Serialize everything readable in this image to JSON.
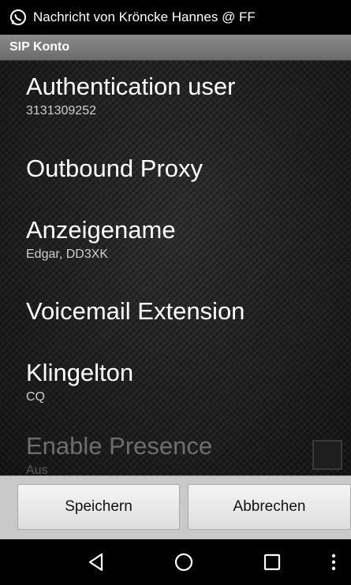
{
  "status_bar": {
    "notification_icon": "whatsapp-icon",
    "notification_text": "Nachricht von Kröncke Hannes @ FF"
  },
  "title_bar": {
    "title": "SIP Konto"
  },
  "preferences": [
    {
      "title": "Authentication user",
      "summary": "3131309252",
      "enabled": true
    },
    {
      "title": "Outbound Proxy",
      "summary": "",
      "enabled": true
    },
    {
      "title": "Anzeigename",
      "summary": "Edgar, DD3XK",
      "enabled": true
    },
    {
      "title": "Voicemail Extension",
      "summary": "",
      "enabled": true
    },
    {
      "title": "Klingelton",
      "summary": "CQ",
      "enabled": true
    },
    {
      "title": "Enable Presence",
      "summary": "Aus",
      "enabled": false,
      "checkbox_checked": false
    }
  ],
  "buttons": {
    "save": "Speichern",
    "cancel": "Abbrechen"
  },
  "nav_bar": {
    "back": "back-icon",
    "home": "home-icon",
    "recents": "recents-icon",
    "menu": "overflow-menu-icon"
  }
}
